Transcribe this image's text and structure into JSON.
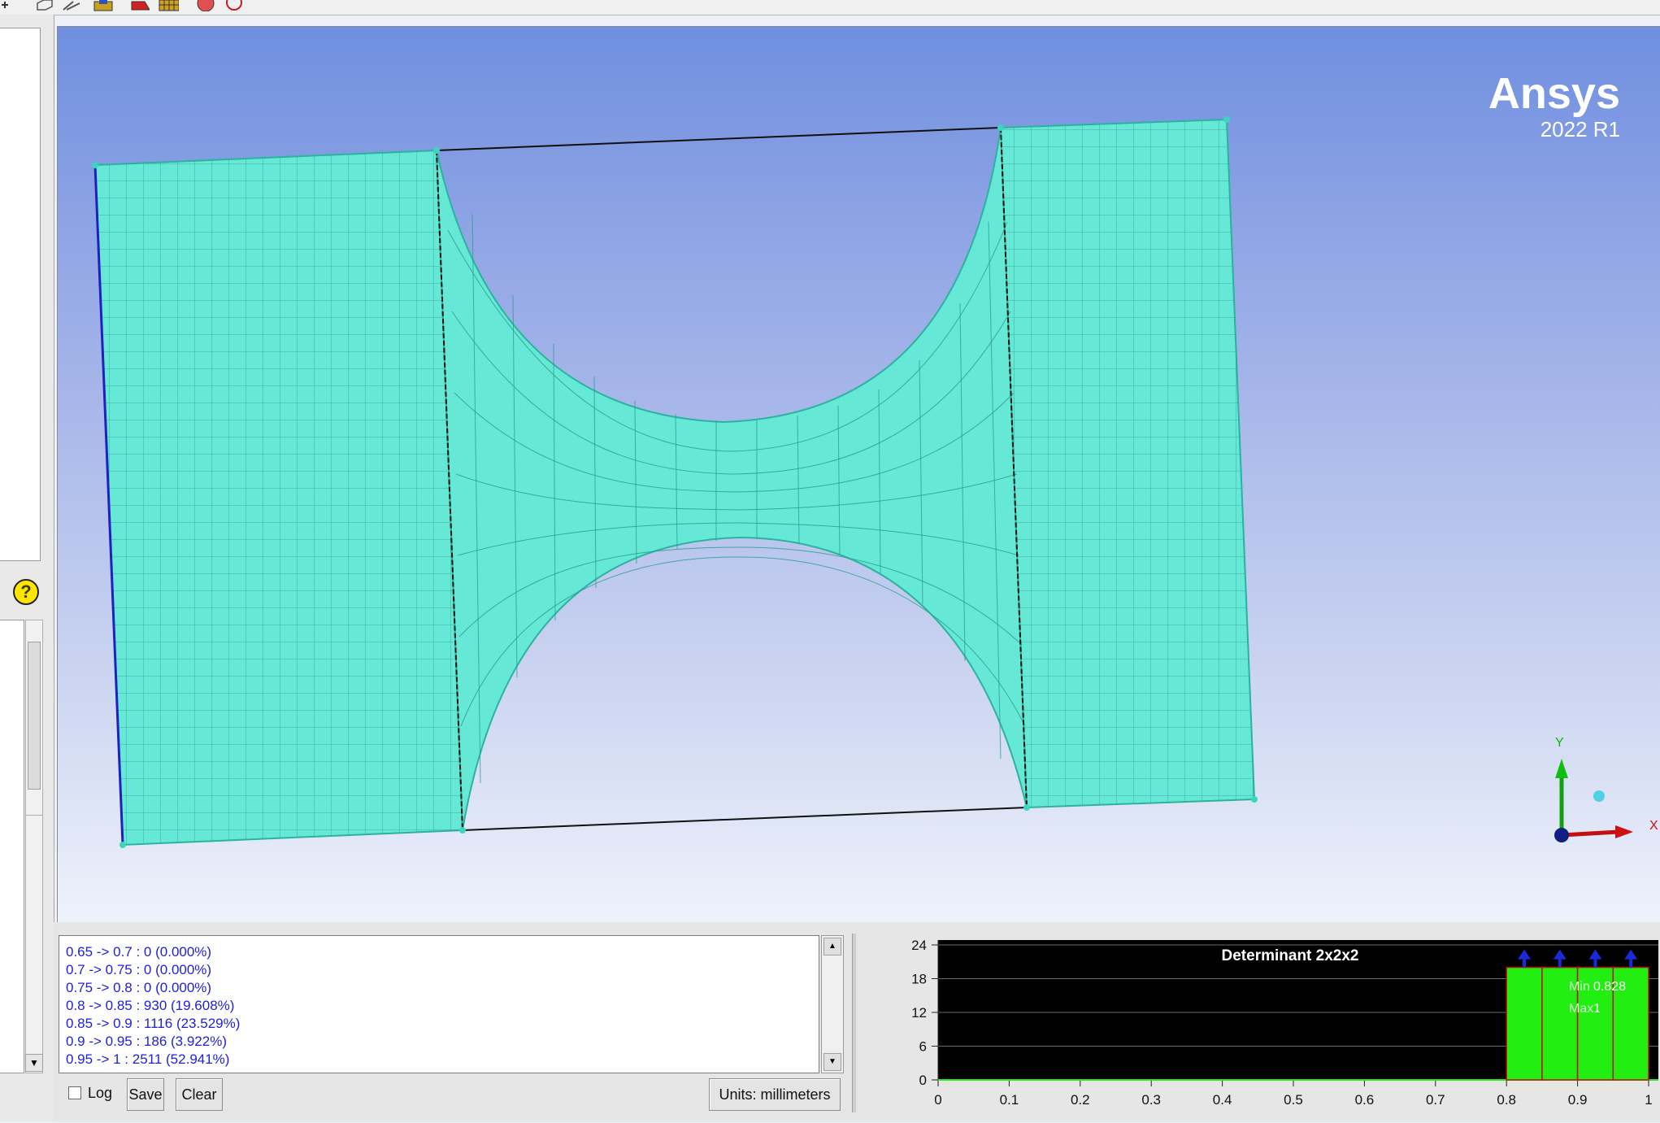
{
  "viewport": {
    "brand_name": "Ansys",
    "brand_version": "2022 R1",
    "axis_y_label": "Y",
    "axis_x_label": "X"
  },
  "log": {
    "lines": [
      "0.65 -> 0.7 : 0 (0.000%)",
      "0.7 -> 0.75 : 0 (0.000%)",
      "0.75 -> 0.8 : 0 (0.000%)",
      "0.8 -> 0.85 : 930 (19.608%)",
      "0.85 -> 0.9 : 1116 (23.529%)",
      "0.9 -> 0.95 : 186 (3.922%)",
      "0.95 -> 1 : 2511 (52.941%)"
    ],
    "log_label": "Log",
    "save_label": "Save",
    "clear_label": "Clear",
    "units_label": "Units: millimeters"
  },
  "chart_data": {
    "type": "bar",
    "title": "Determinant 2x2x2",
    "x_ticks": [
      "0",
      "0.1",
      "0.2",
      "0.3",
      "0.4",
      "0.5",
      "0.6",
      "0.7",
      "0.8",
      "0.9",
      "1"
    ],
    "y_ticks": [
      "0",
      "6",
      "12",
      "18",
      "24"
    ],
    "xlim": [
      0,
      1
    ],
    "ylim": [
      0,
      24
    ],
    "bins": [
      {
        "from": 0.8,
        "to": 0.85,
        "count": 930
      },
      {
        "from": 0.85,
        "to": 0.9,
        "count": 1116
      },
      {
        "from": 0.9,
        "to": 0.95,
        "count": 186
      },
      {
        "from": 0.95,
        "to": 1.0,
        "count": 2511
      }
    ],
    "bar_display_height": 20,
    "min_label": "Min",
    "min_value": "0.828",
    "max_label": "Max",
    "max_value": "1",
    "background": "#000000",
    "bar_color": "#22ee11",
    "grid": true
  }
}
